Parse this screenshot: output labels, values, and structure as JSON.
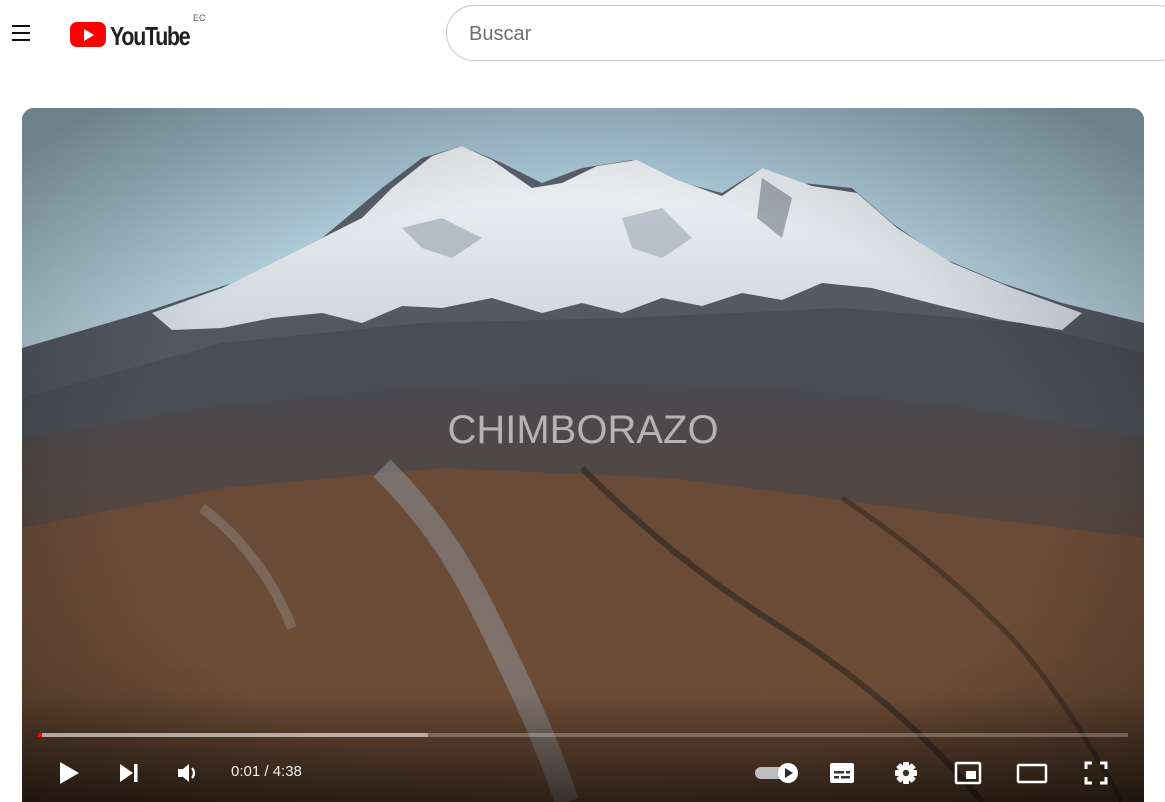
{
  "header": {
    "logo_text": "YouTube",
    "country_code": "EC",
    "search_placeholder": "Buscar"
  },
  "player": {
    "video_title_overlay": "CHIMBORAZO",
    "time_display": "0:01 / 4:38",
    "progress_played_fraction": 0.004,
    "progress_buffered_fraction": 0.358,
    "autoplay_on": true,
    "accent_color": "#ff0000"
  },
  "icons": {
    "menu": "hamburger-menu-icon",
    "play": "play-icon",
    "next": "next-icon",
    "volume": "volume-icon",
    "autoplay": "autoplay-toggle-icon",
    "subtitles": "subtitles-icon",
    "settings": "settings-icon",
    "miniplayer": "miniplayer-icon",
    "theater": "theater-mode-icon",
    "fullscreen": "fullscreen-icon"
  }
}
